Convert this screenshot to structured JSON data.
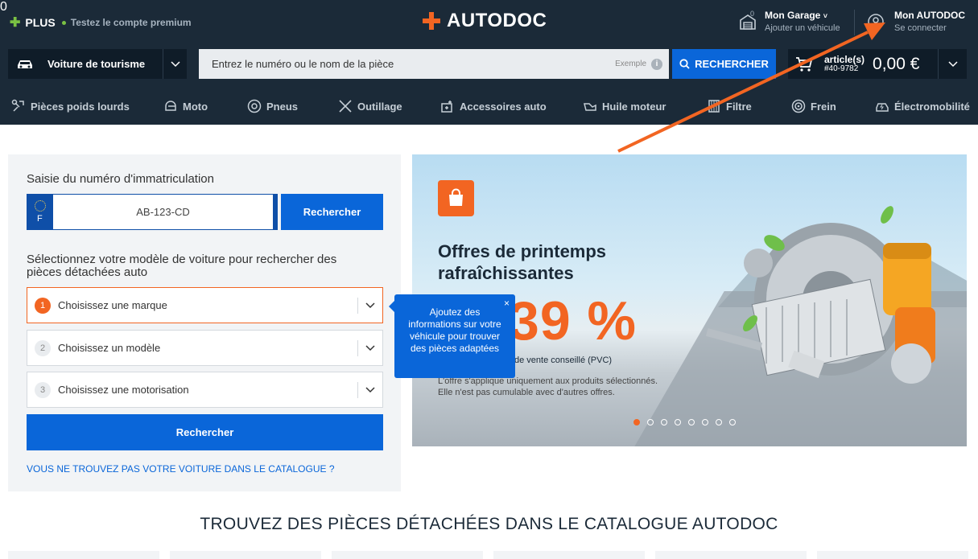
{
  "header": {
    "plus_label": "PLUS",
    "plus_promo": "Testez le compte premium",
    "logo": "AUTODOC",
    "garage": {
      "title": "Mon Garage",
      "subtitle": "Ajouter un véhicule",
      "count": "0"
    },
    "account": {
      "title": "Mon AUTODOC",
      "subtitle": "Se connecter"
    }
  },
  "search": {
    "vehicle_type": "Voiture de tourisme",
    "placeholder": "Entrez le numéro ou le nom de la pièce",
    "example_label": "Exemple",
    "button_label": "RECHERCHER"
  },
  "cart": {
    "count": "0",
    "articles": "article(s)",
    "ref": "#40-9782",
    "total": "0,00 €"
  },
  "nav": {
    "items": [
      "Pièces poids lourds",
      "Moto",
      "Pneus",
      "Outillage",
      "Accessoires auto",
      "Huile moteur",
      "Filtre",
      "Frein",
      "Électromobilité"
    ]
  },
  "finder": {
    "plate_title": "Saisie du numéro d'immatriculation",
    "plate_country": "F",
    "plate_value": "AB-123-CD",
    "plate_button": "Rechercher",
    "model_title": "Sélectionnez votre modèle de voiture pour rechercher des pièces détachées auto",
    "selects": [
      {
        "n": "1",
        "label": "Choisissez une marque"
      },
      {
        "n": "2",
        "label": "Choisissez un modèle"
      },
      {
        "n": "3",
        "label": "Choisissez une motorisation"
      }
    ],
    "search_button": "Rechercher",
    "missing_link": "VOUS NE TROUVEZ PAS VOTRE VOITURE DANS LE CATALOGUE ?"
  },
  "tooltip": {
    "text": "Ajoutez des informations sur votre véhicule pour trouver des pièces adaptées",
    "close": "×"
  },
  "banner": {
    "title": "Offres de printemps rafraîchissantes",
    "discount": "39 %",
    "pvc": "de vente conseillé (PVC)",
    "note_line1": "L'offre s'applique uniquement aux produits sélectionnés.",
    "note_line2": "Elle n'est pas cumulable avec d'autres offres.",
    "slides": 8,
    "active_slide": 1
  },
  "catalog": {
    "title": "TROUVEZ DES PIÈCES DÉTACHÉES DANS LE CATALOGUE AUTODOC"
  },
  "colors": {
    "brand_orange": "#f26522",
    "primary_blue": "#0a66d9",
    "header_bg": "#1b2a38"
  }
}
